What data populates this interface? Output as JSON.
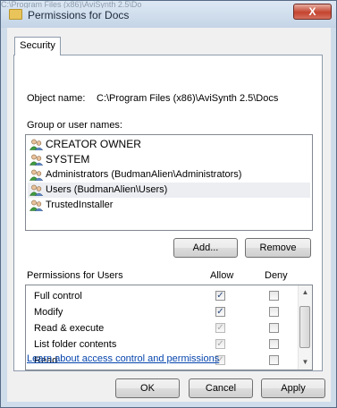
{
  "window": {
    "background_title": "C:\\Program Files (x86)\\AviSynth 2.5\\Do",
    "title": "Permissions for Docs",
    "close_label": "X"
  },
  "tabs": [
    {
      "label": "Security"
    }
  ],
  "object": {
    "label": "Object name:",
    "value": "C:\\Program Files (x86)\\AviSynth 2.5\\Docs"
  },
  "groups": {
    "label": "Group or user names:",
    "items": [
      {
        "label": "CREATOR OWNER",
        "icon": "group-icon"
      },
      {
        "label": "SYSTEM",
        "icon": "group-icon"
      },
      {
        "label": "Administrators (BudmanAlien\\Administrators)",
        "icon": "group-icon"
      },
      {
        "label": "Users (BudmanAlien\\Users)",
        "icon": "group-icon",
        "selected": true
      },
      {
        "label": "TrustedInstaller",
        "icon": "group-icon"
      }
    ]
  },
  "buttons": {
    "add": "Add...",
    "remove": "Remove",
    "ok": "OK",
    "cancel": "Cancel",
    "apply": "Apply"
  },
  "permissions": {
    "label": "Permissions for Users",
    "allow_label": "Allow",
    "deny_label": "Deny",
    "rows": [
      {
        "label": "Full control",
        "allow": true,
        "allow_disabled": false,
        "deny": false
      },
      {
        "label": "Modify",
        "allow": true,
        "allow_disabled": false,
        "deny": false
      },
      {
        "label": "Read & execute",
        "allow": true,
        "allow_disabled": true,
        "deny": false
      },
      {
        "label": "List folder contents",
        "allow": true,
        "allow_disabled": true,
        "deny": false
      },
      {
        "label": "Read",
        "allow": true,
        "allow_disabled": true,
        "deny": false
      }
    ]
  },
  "help_link": "Learn about access control and permissions",
  "colors": {
    "title_bar": "#cfdcea",
    "close_button": "#c4442f",
    "link": "#0645ad",
    "selection": "#eceef2"
  }
}
